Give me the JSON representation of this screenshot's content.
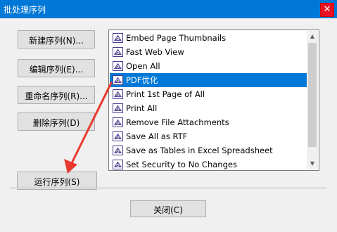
{
  "window": {
    "title": "批处理序列",
    "close_glyph": "✕"
  },
  "buttons": {
    "new": "新建序列(N)...",
    "edit": "编辑序列(E)...",
    "rename": "重命名序列(R)...",
    "delete": "删除序列(D)",
    "run": "运行序列(S)",
    "close": "关闭(C)"
  },
  "sequences": [
    {
      "label": "Embed Page Thumbnails",
      "icon": "sequence-icon",
      "selected": false
    },
    {
      "label": "Fast Web View",
      "icon": "sequence-icon",
      "selected": false
    },
    {
      "label": "Open All",
      "icon": "sequence-icon",
      "selected": false
    },
    {
      "label": "PDF优化",
      "icon": "sequence-icon",
      "selected": true
    },
    {
      "label": "Print 1st Page of All",
      "icon": "sequence-icon",
      "selected": false
    },
    {
      "label": "Print All",
      "icon": "sequence-icon",
      "selected": false
    },
    {
      "label": "Remove File Attachments",
      "icon": "sequence-icon",
      "selected": false
    },
    {
      "label": "Save All as RTF",
      "icon": "sequence-icon",
      "selected": false
    },
    {
      "label": "Save as Tables in Excel Spreadsheet",
      "icon": "sequence-icon",
      "selected": false
    },
    {
      "label": "Set Security to No Changes",
      "icon": "sequence-icon",
      "selected": false
    }
  ],
  "colors": {
    "title_bar": "#0078d7",
    "selection": "#0078d7",
    "annotation_arrow": "#e83a2e",
    "close_button": "#e81123"
  }
}
